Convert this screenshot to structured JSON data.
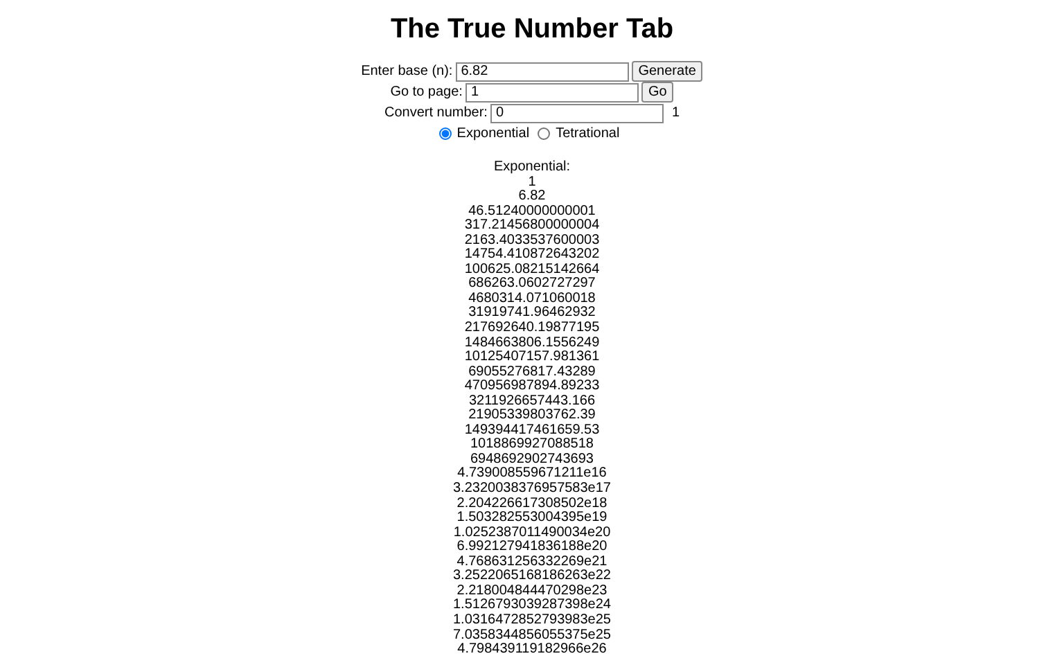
{
  "title": "The True Number Tab",
  "base": {
    "label": "Enter base (n):",
    "value": "6.82",
    "button": "Generate"
  },
  "page": {
    "label": "Go to page:",
    "value": "1",
    "button": "Go"
  },
  "convert": {
    "label": "Convert number:",
    "value": "0",
    "result": "1"
  },
  "modes": [
    {
      "label": "Exponential",
      "selected": true
    },
    {
      "label": "Tetrational",
      "selected": false
    }
  ],
  "results": {
    "heading": "Exponential:",
    "values": [
      "1",
      "6.82",
      "46.51240000000001",
      "317.21456800000004",
      "2163.4033537600003",
      "14754.410872643202",
      "100625.08215142664",
      "686263.0602727297",
      "4680314.071060018",
      "31919741.96462932",
      "217692640.19877195",
      "1484663806.1556249",
      "10125407157.981361",
      "69055276817.43289",
      "470956987894.89233",
      "3211926657443.166",
      "21905339803762.39",
      "149394417461659.53",
      "1018869927088518",
      "6948692902743693",
      "4.739008559671211e16",
      "3.2320038376957583e17",
      "2.204226617308502e18",
      "1.503282553004395e19",
      "1.0252387011490034e20",
      "6.992127941836188e20",
      "4.768631256332269e21",
      "3.2522065168186263e22",
      "2.218004844470298e23",
      "1.5126793039287398e24",
      "1.0316472852793983e25",
      "7.0358344856055375e25",
      "4.798439119182966e26"
    ]
  }
}
